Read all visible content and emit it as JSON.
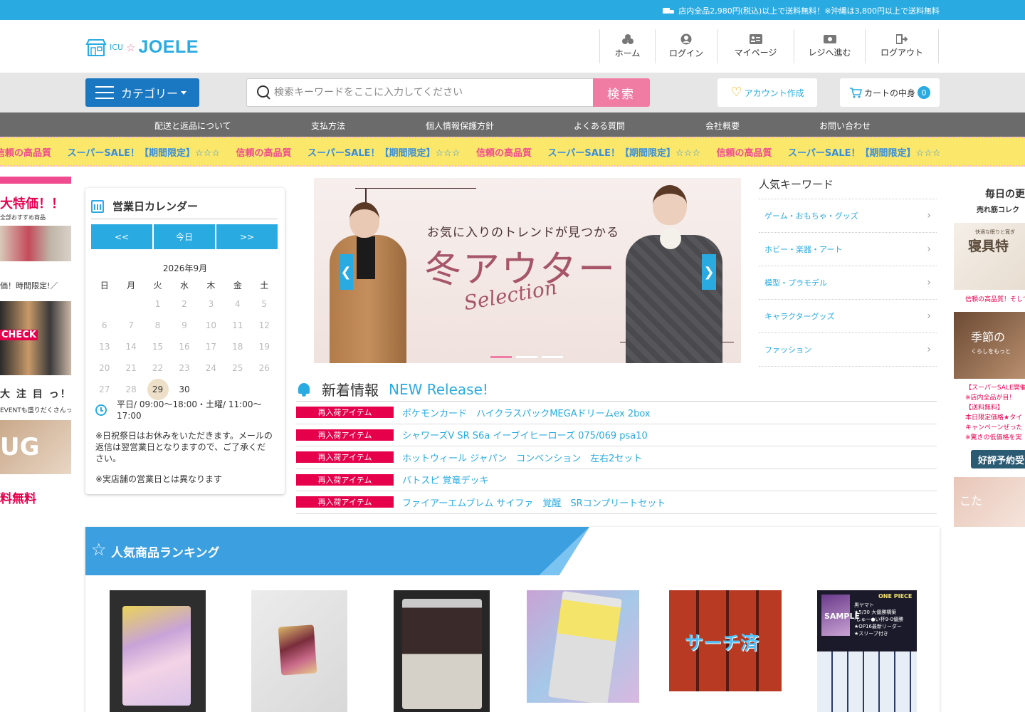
{
  "topbar": {
    "notice": "店内全品2,980円(税込)以上で送料無料！※沖縄は3,800円以上で送料無料"
  },
  "logo": {
    "small": "ICU",
    "star": "☆",
    "big": "JOELE"
  },
  "header_nav": [
    {
      "label": "ホーム",
      "icon": "home-icon"
    },
    {
      "label": "ログイン",
      "icon": "user-icon"
    },
    {
      "label": "マイページ",
      "icon": "id-card-icon"
    },
    {
      "label": "レジへ進む",
      "icon": "money-icon"
    },
    {
      "label": "ログアウト",
      "icon": "logout-icon"
    }
  ],
  "search": {
    "category_label": "カテゴリー",
    "placeholder": "検索キーワードをここに入力してください",
    "button_label": "検索",
    "account_label": "アカウント作成",
    "cart_label": "カートの中身",
    "cart_count": "0"
  },
  "global_nav": [
    "配送と返品について",
    "支払方法",
    "個人情報保護方針",
    "よくある質問",
    "会社概要",
    "お問い合わせ"
  ],
  "ticker": {
    "text1": "スーパーSALE！【期間限定】☆☆☆",
    "text2": "信頼の高品質"
  },
  "left_promo": {
    "title1": "大特価！！",
    "sub1": "全部おすすめ商品",
    "sub2": "価！時間限定!／",
    "check": "CHECK",
    "title2": "大 注 目 っ！",
    "sub3": "EVENTも盛りだくさんっ",
    "img_text": "UG",
    "title3": "料無料"
  },
  "calendar": {
    "title": "営業日カレンダー",
    "prev": "<<",
    "today": "今日",
    "next": ">>",
    "month": "2026年9月",
    "weekdays": [
      "日",
      "月",
      "火",
      "水",
      "木",
      "金",
      "土"
    ],
    "weeks": [
      [
        "",
        "",
        "1",
        "2",
        "3",
        "4",
        "5"
      ],
      [
        "6",
        "7",
        "8",
        "9",
        "10",
        "11",
        "12"
      ],
      [
        "13",
        "14",
        "15",
        "16",
        "17",
        "18",
        "19"
      ],
      [
        "20",
        "21",
        "22",
        "23",
        "24",
        "25",
        "26"
      ],
      [
        "27",
        "28",
        "29",
        "30",
        "",
        "",
        ""
      ]
    ],
    "today_day": "29",
    "hours": "平日/ 09:00～18:00・土曜/ 11:00～17:00",
    "note1": "※日祝祭日はお休みをいただきます。メールの返信は翌営業日となりますので、ご了承ください。",
    "note2": "※実店舗の営業日とは異なります"
  },
  "slider": {
    "line1": "お気に入りのトレンドが見つかる",
    "line2": "冬アウター",
    "line3": "Selection",
    "prev": "❮",
    "next": "❯",
    "slide_count": 3,
    "active_slide": 1
  },
  "keywords": {
    "title": "人気キーワード",
    "items": [
      "ゲーム・おもちゃ・グッズ",
      "ホビー・楽器・アート",
      "模型・プラモデル",
      "キャラクターグッズ",
      "ファッション"
    ]
  },
  "right_promo": {
    "title1": "毎日の更",
    "sub1": "売れ筋コレク",
    "img1_small": "快適な眠りと寛ぎ",
    "img1": "寝具特",
    "sub2": "信頼の高品質！そして安",
    "img2": "季節の",
    "img2_small": "くらしをもっと",
    "lines": [
      "【スーパーSALE開催",
      "※店内全品が目！",
      "【送料無料】",
      "本日限定価格★タイ",
      "キャンペーンぜった",
      "※驚きの低価格を実"
    ],
    "button": "好評予約受",
    "img3": "こた"
  },
  "news": {
    "title": "新着情報",
    "subtitle": "NEW Release!",
    "items": [
      {
        "tag": "再入荷アイテム",
        "text": "ポケモンカード　ハイクラスパックMEGAドリームex 2box"
      },
      {
        "tag": "再入荷アイテム",
        "text": "シャワーズV SR S6a イーブイヒーローズ 075/069 psa10"
      },
      {
        "tag": "再入荷アイテム",
        "text": "ホットウィール ジャパン　コンベンション　左右2セット"
      },
      {
        "tag": "再入荷アイテム",
        "text": "バトスピ 覚竜デッキ"
      },
      {
        "tag": "再入荷アイテム",
        "text": "ファイアーエムブレム サイファ　覚醒　SRコンプリートセット"
      }
    ]
  },
  "ranking": {
    "title": "人気商品ランキング",
    "products": [
      {
        "name": "product-card-1"
      },
      {
        "name": "product-card-2"
      },
      {
        "name": "product-card-3"
      },
      {
        "name": "product-card-4"
      },
      {
        "name": "product-card-5",
        "overlay": "サーチ済"
      },
      {
        "name": "product-card-6",
        "overlay": "SAMPLE",
        "brand": "ONE PIECE",
        "lines": [
          "黒ヤマト",
          "★5/30 大優勝構築",
          "-しゅー●い杯9-0優勝",
          "★OP16最新リーダー",
          "★スリーブ付き"
        ]
      }
    ]
  },
  "colors": {
    "accent": "#29abe2",
    "pink": "#f07ca3",
    "tag": "#e6004c",
    "nav": "#6b6b6b",
    "category": "#1a78c2"
  }
}
